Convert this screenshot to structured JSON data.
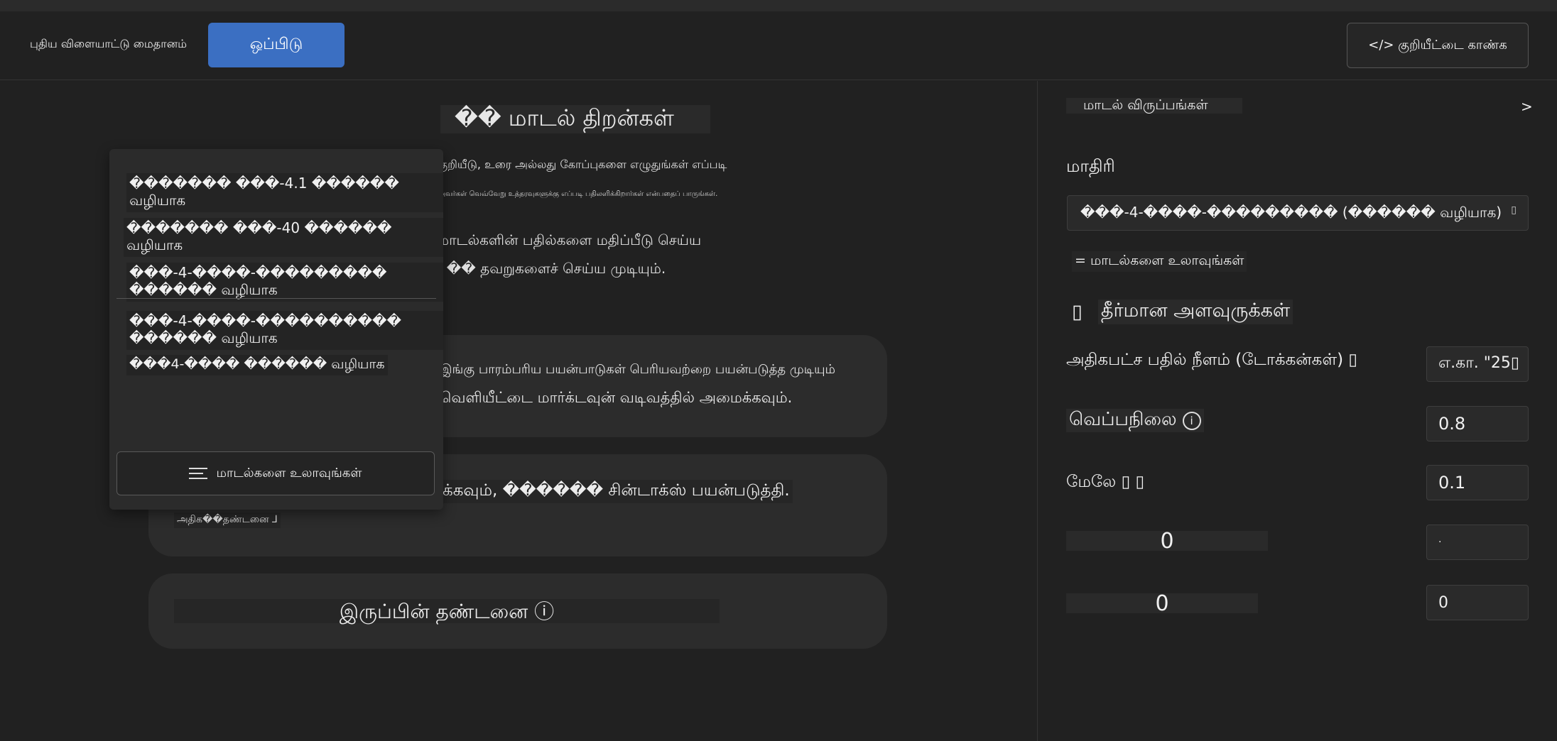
{
  "header": {
    "brand": "புதிய விளையாட்டு மைதானம்",
    "compare_button": "ஒப்பிடு",
    "view_code_button": "</> குறியீட்டை காண்க"
  },
  "main": {
    "title": "�� மாடல் திறன்கள்",
    "desc_line1": "குறியீடு, உரை அல்லது கோப்புகளை எழுதுங்கள் எப்படி",
    "desc_line2": "அவர்கள் வெவ்வேறு உத்தரவுகளுக்கு எப்படி பதிலளிக்கிறார்கள் என்பதைப் பாருங்கள்.",
    "desc_line3": "மாடல்களின் பதில்களை மதிப்பீடு செய்ய",
    "desc_line4": "· �� தவறுகளைச் செய்ய முடியும்.",
    "cards": [
      {
        "line1": "இங்கு பாரம்பரிய பயன்பாடுகள் பெரியவற்றை பயன்படுத்த முடியும்",
        "line2": "வெளியீட்டை மார்க்டவுன் வடிவத்தில் அமைக்கவும்."
      },
      {
        "line1": "பூரியர் மாற்றத்தின் சூத்திரத்தை விளக்கவும், ������ சின்டாக்ஸ் பயன்படுத்தி.",
        "line2": "அதிக��தண்டனை ⅃"
      },
      {
        "line1": "இருப்பின் தண்டனை ⓘ"
      }
    ]
  },
  "dropdown": {
    "items": [
      "������� ���-4.1 ������ வழியாக",
      "������� ���-40 ������ வழியாக",
      "���-4-����-��������� ������ வழியாக",
      "���-4-����-���������� ������ வழியாக",
      "���4-���� ������ வழியாக"
    ],
    "browse": "மாடல்களை உலாவுங்கள்"
  },
  "panel": {
    "prefs_header": "மாடல் விருப்பங்கள்",
    "prefs_chevron": ">",
    "model_label": "மாதிரி",
    "model_value": "���-4-����-��������� (������ வழியாக)",
    "model_caret": "▯",
    "browse_link": "= மாடல்களை உலாவுங்கள்",
    "params_icon": "▯",
    "params_header": "தீர்மான அளவுருக்கள்",
    "max_tokens_label": "அதிகபட்ச பதில் நீளம் (டோக்கன்கள்) ▯",
    "max_tokens_value": "எ.கா. \"25▯",
    "temperature_label": "வெப்பநிலை",
    "temperature_info": "i",
    "temperature_value": "0.8",
    "top_p_label": "மேலே ▯ ▯",
    "top_p_value": "0.1",
    "freq_label": "0",
    "freq_value": "·",
    "presence_label": "0",
    "presence_value": "0"
  }
}
